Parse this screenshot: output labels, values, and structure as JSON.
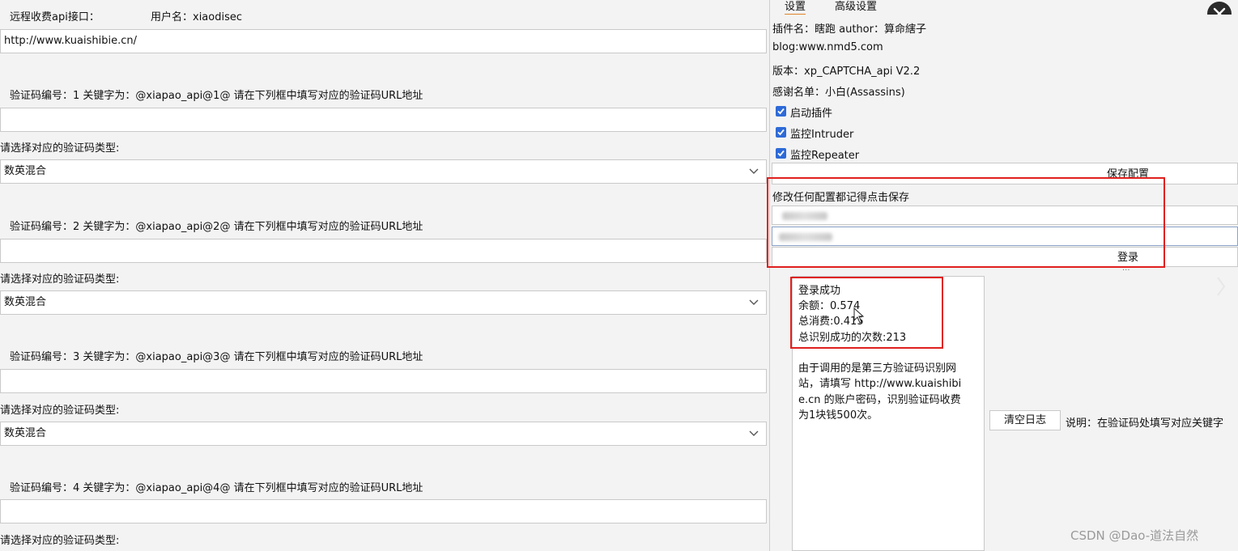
{
  "left": {
    "api_label": "远程收费api接口：",
    "username_label": "用户名：xiaodisec",
    "api_url": "http://www.kuaishibie.cn/",
    "captchas": [
      {
        "header": "验证码编号：1  关键字为：@xiapao_api@1@    请在下列框中填写对应的验证码URL地址",
        "type_label": "请选择对应的验证码类型:",
        "type_value": "数英混合"
      },
      {
        "header": "验证码编号：2  关键字为：@xiapao_api@2@    请在下列框中填写对应的验证码URL地址",
        "type_label": "请选择对应的验证码类型:",
        "type_value": "数英混合"
      },
      {
        "header": "验证码编号：3  关键字为：@xiapao_api@3@    请在下列框中填写对应的验证码URL地址",
        "type_label": "请选择对应的验证码类型:",
        "type_value": "数英混合"
      },
      {
        "header": "验证码编号：4  关键字为：@xiapao_api@4@    请在下列框中填写对应的验证码URL地址",
        "type_label": "请选择对应的验证码类型:",
        "type_value": ""
      }
    ]
  },
  "tabs": {
    "settings": "设置",
    "advanced": "高级设置"
  },
  "plugin": {
    "name_line": "插件名：瞎跑 author：算命縖子",
    "blog_line": "blog:www.nmd5.com",
    "version_line": "版本：xp_CAPTCHA_api V2.2",
    "thanks_line": "感谢名单：小白(Assassins)"
  },
  "checkboxes": {
    "enable": "启动插件",
    "intruder": "监控Intruder",
    "repeater": "监控Repeater"
  },
  "buttons": {
    "save": "保存配置",
    "login": "登录",
    "clear_log": "清空日志"
  },
  "save_hint": "修改任何配置都记得点击保存",
  "log": {
    "success": "登录成功",
    "balance": "余额：0.574",
    "spent": "总消费:0.415",
    "count": "总识别成功的次数:213",
    "note": [
      "由于调用的是第三方验证码识别网",
      "站，请填写 http://www.kuaishibi",
      "e.cn 的账户密码，识别验证码收费",
      "为1块钱500次。"
    ]
  },
  "explain": "说明：在验证码处填写对应关键字",
  "watermark": "CSDN @Dao-道法自然",
  "colors": {
    "highlight_red": "#e0201e",
    "checkbox_blue": "#2d6ad8",
    "tab_underline": "#e0842c"
  }
}
